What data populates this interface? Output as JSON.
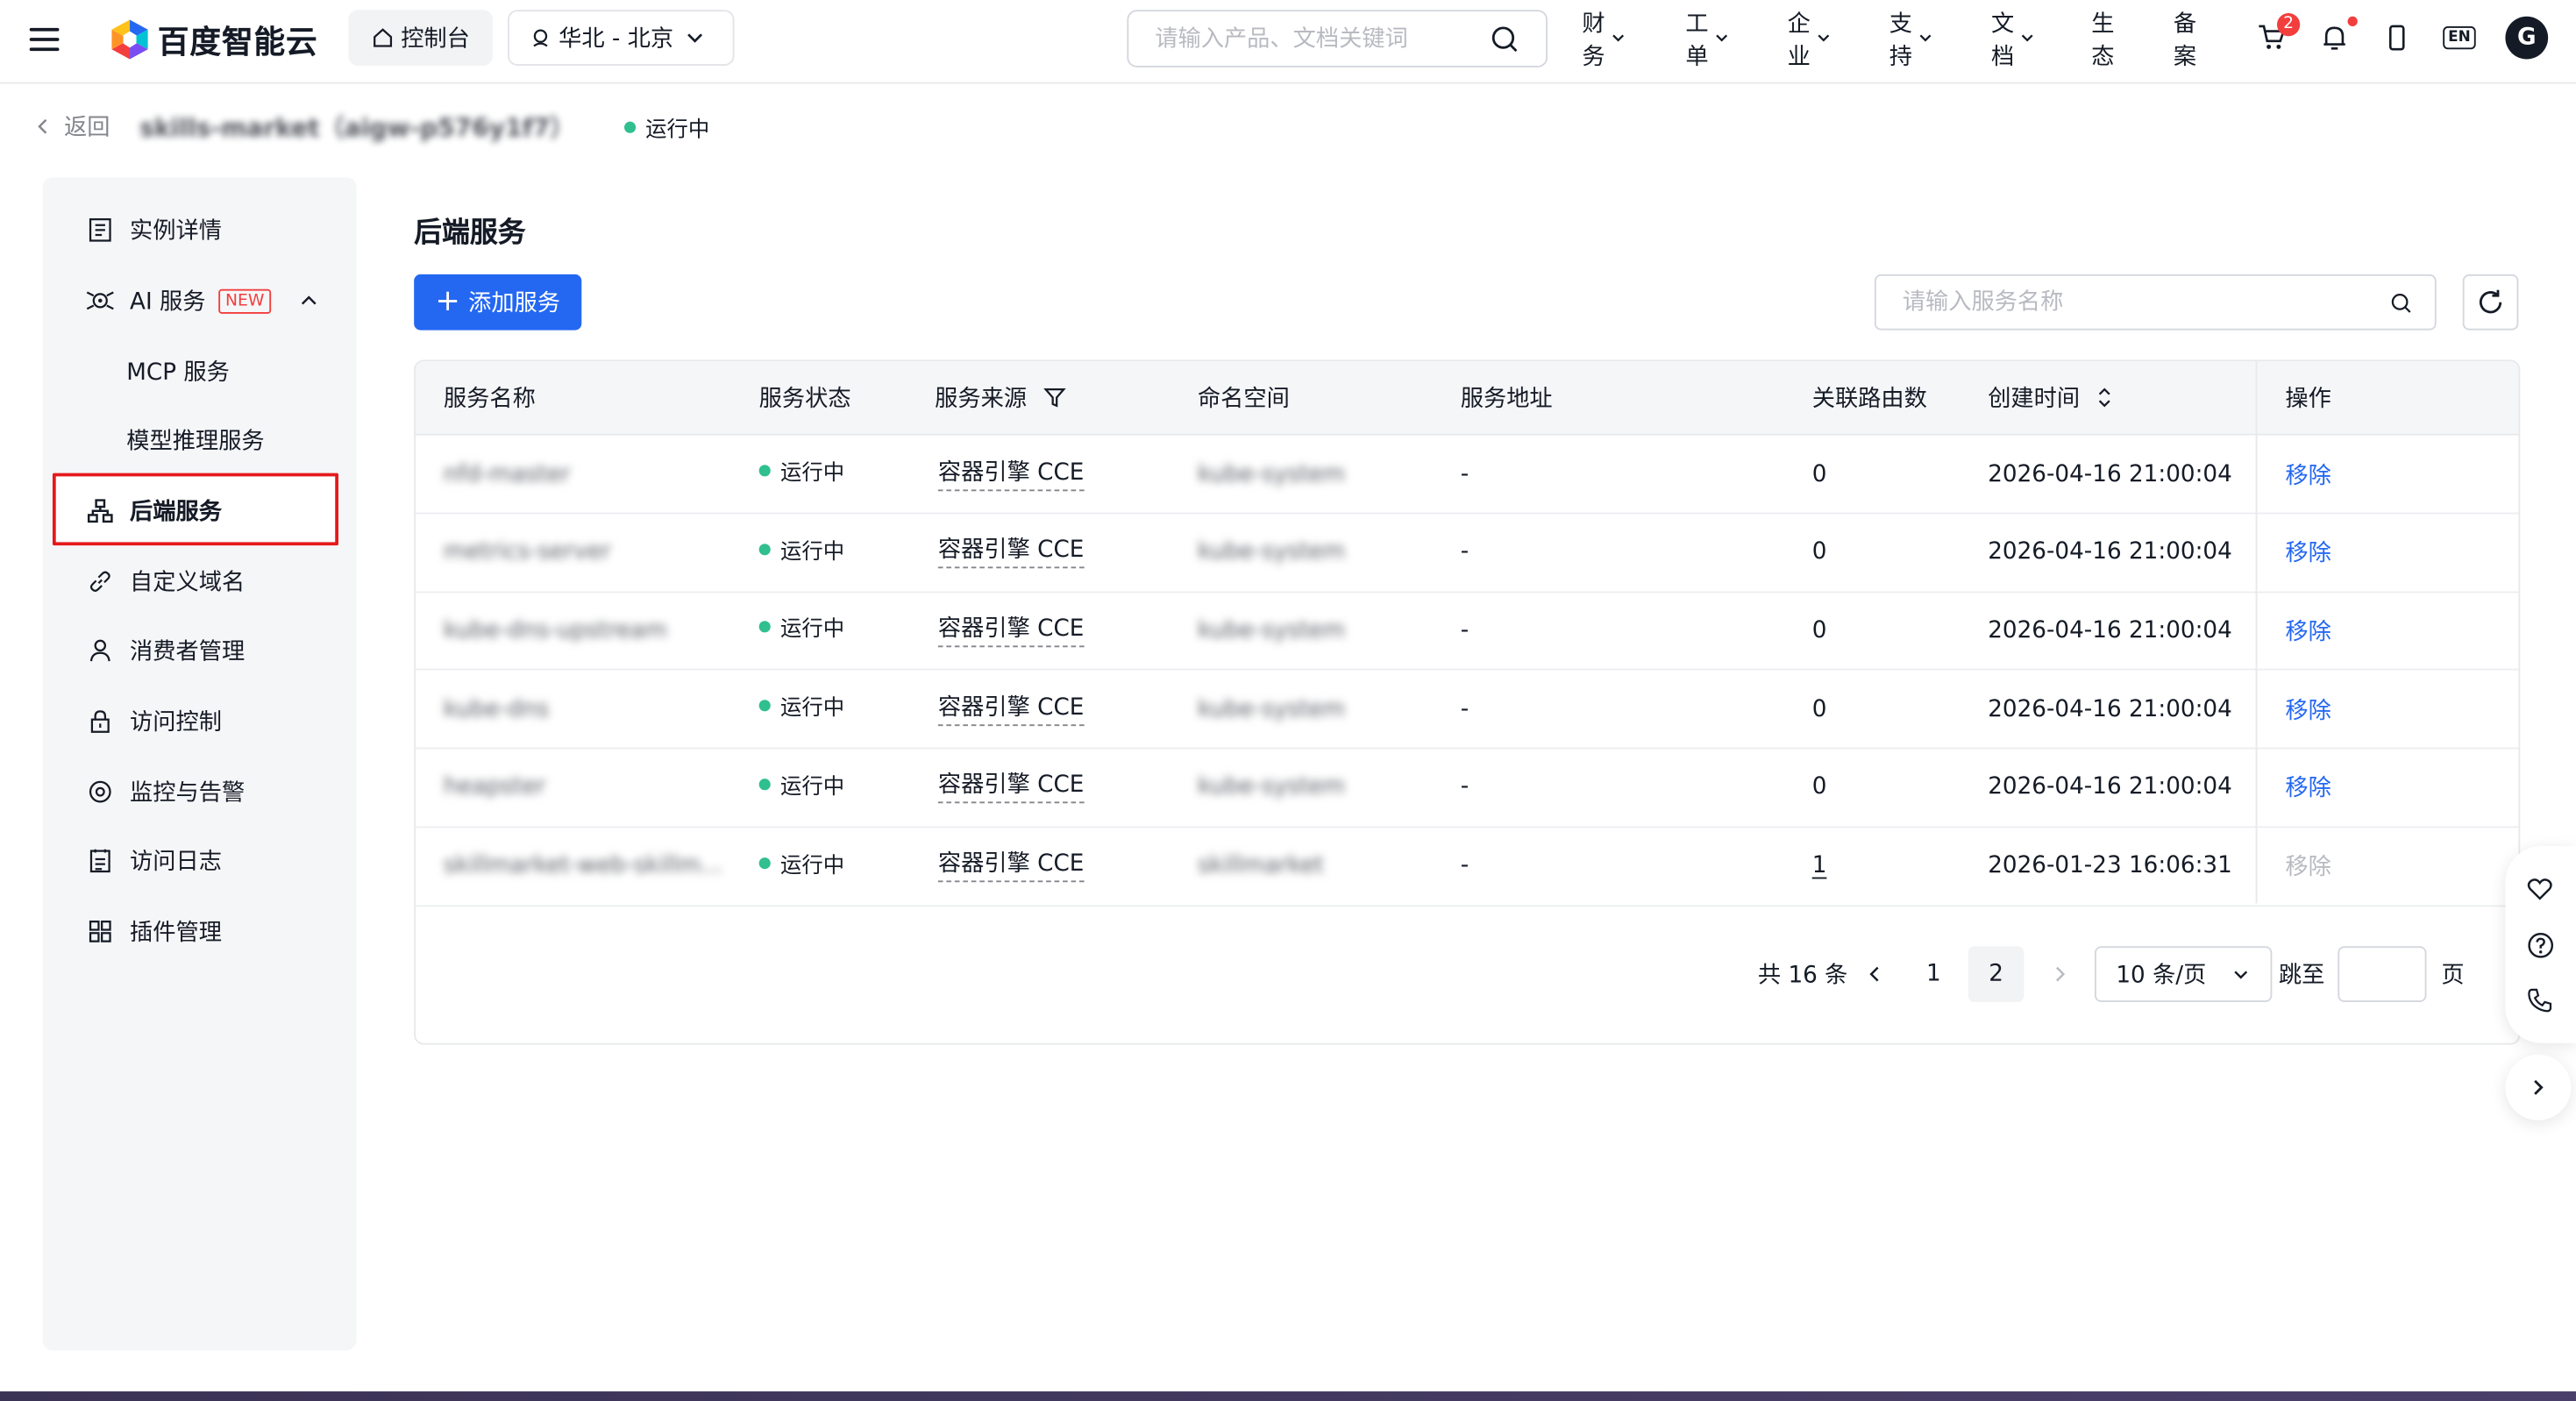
{
  "topnav": {
    "brand": "百度智能云",
    "console_label": "控制台",
    "region_label": "华北 - 北京",
    "search_placeholder": "请输入产品、文档关键词",
    "links": [
      {
        "label": "财务",
        "has_dropdown": true
      },
      {
        "label": "工单",
        "has_dropdown": true
      },
      {
        "label": "企业",
        "has_dropdown": true
      },
      {
        "label": "支持",
        "has_dropdown": true
      },
      {
        "label": "文档",
        "has_dropdown": true
      },
      {
        "label": "生态",
        "has_dropdown": false
      },
      {
        "label": "备案",
        "has_dropdown": false
      }
    ],
    "cart_badge": "2",
    "lang_label": "EN",
    "avatar_letter": "G"
  },
  "breadcrumb": {
    "back_label": "返回",
    "instance_title": "skills-market（aigw-p576y1f7）",
    "status": "运行中"
  },
  "sidebar": {
    "items": [
      {
        "label": "实例详情",
        "icon": "list-doc-icon"
      },
      {
        "label": "AI 服务",
        "icon": "ai-bot-icon",
        "tag": "NEW"
      },
      {
        "label": "MCP 服务",
        "sub": true
      },
      {
        "label": "模型推理服务",
        "sub": true
      },
      {
        "label": "后端服务",
        "icon": "hierarchy-icon",
        "active": true
      },
      {
        "label": "自定义域名",
        "icon": "link-icon"
      },
      {
        "label": "消费者管理",
        "icon": "user-icon"
      },
      {
        "label": "访问控制",
        "icon": "lock-icon"
      },
      {
        "label": "监控与告警",
        "icon": "monitor-icon"
      },
      {
        "label": "访问日志",
        "icon": "log-icon"
      },
      {
        "label": "插件管理",
        "icon": "grid-icon"
      }
    ]
  },
  "main": {
    "title": "后端服务",
    "add_button": "添加服务",
    "search_placeholder": "请输入服务名称",
    "columns": [
      "服务名称",
      "服务状态",
      "服务来源",
      "命名空间",
      "服务地址",
      "关联路由数",
      "创建时间",
      "操作"
    ],
    "rows": [
      {
        "name": "nfd-master",
        "status": "运行中",
        "source": "容器引擎 CCE",
        "namespace": "kube-system",
        "address": "-",
        "routes": "0",
        "created": "2026-04-16 21:00:04",
        "action": "移除",
        "action_enabled": true
      },
      {
        "name": "metrics-server",
        "status": "运行中",
        "source": "容器引擎 CCE",
        "namespace": "kube-system",
        "address": "-",
        "routes": "0",
        "created": "2026-04-16 21:00:04",
        "action": "移除",
        "action_enabled": true
      },
      {
        "name": "kube-dns-upstream",
        "status": "运行中",
        "source": "容器引擎 CCE",
        "namespace": "kube-system",
        "address": "-",
        "routes": "0",
        "created": "2026-04-16 21:00:04",
        "action": "移除",
        "action_enabled": true
      },
      {
        "name": "kube-dns",
        "status": "运行中",
        "source": "容器引擎 CCE",
        "namespace": "kube-system",
        "address": "-",
        "routes": "0",
        "created": "2026-04-16 21:00:04",
        "action": "移除",
        "action_enabled": true
      },
      {
        "name": "heapster",
        "status": "运行中",
        "source": "容器引擎 CCE",
        "namespace": "kube-system",
        "address": "-",
        "routes": "0",
        "created": "2026-04-16 21:00:04",
        "action": "移除",
        "action_enabled": true
      },
      {
        "name": "skillmarket-web-skillm...",
        "status": "运行中",
        "source": "容器引擎 CCE",
        "namespace": "skillmarket",
        "address": "-",
        "routes": "1",
        "created": "2026-01-23 16:06:31",
        "action": "移除",
        "action_enabled": false
      }
    ],
    "pagination": {
      "total": "共 16 条",
      "pages": [
        "1",
        "2"
      ],
      "current": "2",
      "page_size": "10 条/页",
      "jump_label": "跳至",
      "page_suffix": "页"
    }
  },
  "colors": {
    "primary": "#2468f2",
    "running_green": "#30bf8f",
    "highlight_red": "#e5191c",
    "sidebar_bg": "#f5f6f8"
  }
}
